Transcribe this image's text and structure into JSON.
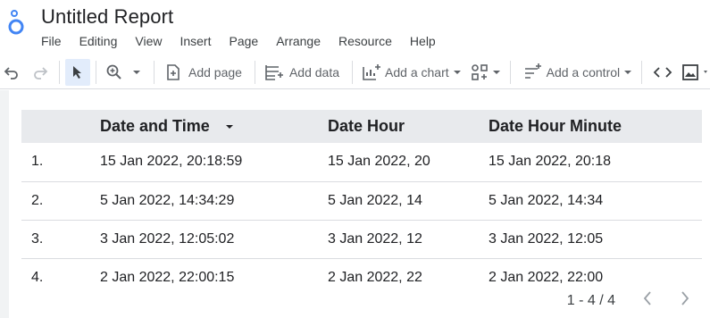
{
  "app": {
    "title": "Untitled Report",
    "logo_icon": "looker-studio-logo-icon"
  },
  "menu": [
    "File",
    "Editing",
    "View",
    "Insert",
    "Page",
    "Arrange",
    "Resource",
    "Help"
  ],
  "toolbar": {
    "undo_icon": "undo-icon",
    "redo_icon": "redo-icon",
    "select_icon": "cursor-icon",
    "zoom_icon": "zoom-icon",
    "add_page_label": "Add page",
    "add_data_label": "Add data",
    "add_chart_label": "Add a chart",
    "add_control_label": "Add a control",
    "code_icon": "code-icon",
    "image_icon": "image-icon"
  },
  "table": {
    "columns": [
      "Date and Time",
      "Date Hour",
      "Date Hour Minute"
    ],
    "rows": [
      {
        "index": "1.",
        "date_time": "15 Jan 2022, 20:18:59",
        "date_hour": "15 Jan 2022, 20",
        "date_hour_minute": "15 Jan 2022, 20:18"
      },
      {
        "index": "2.",
        "date_time": "5 Jan 2022, 14:34:29",
        "date_hour": "5 Jan 2022, 14",
        "date_hour_minute": "5 Jan 2022, 14:34"
      },
      {
        "index": "3.",
        "date_time": "3 Jan 2022, 12:05:02",
        "date_hour": "3 Jan 2022, 12",
        "date_hour_minute": "3 Jan 2022, 12:05"
      },
      {
        "index": "4.",
        "date_time": "2 Jan 2022, 22:00:15",
        "date_hour": "2 Jan 2022, 22",
        "date_hour_minute": "2 Jan 2022, 22:00"
      }
    ]
  },
  "pager": {
    "range": "1 - 4 / 4"
  },
  "colors": {
    "accent": "#4285f4",
    "select_bg": "#e2ecfb",
    "header_bg": "#e8eaed",
    "canvas_bg": "#f1f3f4"
  }
}
